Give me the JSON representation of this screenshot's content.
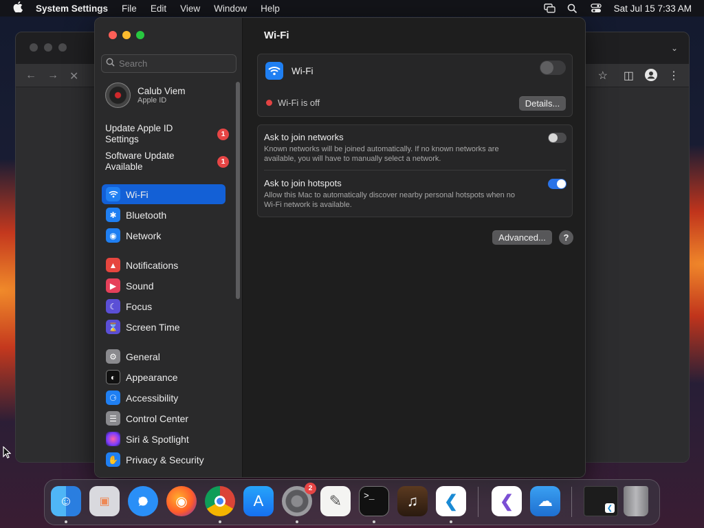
{
  "menubar": {
    "app_name": "System Settings",
    "menus": [
      "File",
      "Edit",
      "View",
      "Window",
      "Help"
    ],
    "clock": "Sat Jul 15  7:33 AM"
  },
  "sidebar": {
    "search_placeholder": "Search",
    "account": {
      "name": "Calub Viem",
      "subtitle": "Apple ID"
    },
    "notices": [
      {
        "label": "Update Apple ID Settings",
        "badge": "1"
      },
      {
        "label": "Software Update Available",
        "badge": "1"
      }
    ],
    "items": [
      {
        "label": "Wi-Fi",
        "icon": "wifi-icon",
        "color": "#1f7ff2"
      },
      {
        "label": "Bluetooth",
        "icon": "bluetooth-icon",
        "color": "#1f7ff2"
      },
      {
        "label": "Network",
        "icon": "globe-icon",
        "color": "#1f7ff2"
      },
      {
        "label": "Notifications",
        "icon": "bell-icon",
        "color": "#e6463f"
      },
      {
        "label": "Sound",
        "icon": "speaker-icon",
        "color": "#e6405a"
      },
      {
        "label": "Focus",
        "icon": "moon-icon",
        "color": "#5b4fd6"
      },
      {
        "label": "Screen Time",
        "icon": "hourglass-icon",
        "color": "#5b4fd6"
      },
      {
        "label": "General",
        "icon": "gear-icon",
        "color": "#8a8a8e"
      },
      {
        "label": "Appearance",
        "icon": "appearance-icon",
        "color": "#1c1c1c"
      },
      {
        "label": "Accessibility",
        "icon": "accessibility-icon",
        "color": "#1f7ff2"
      },
      {
        "label": "Control Center",
        "icon": "control-center-icon",
        "color": "#8a8a8e"
      },
      {
        "label": "Siri & Spotlight",
        "icon": "siri-icon",
        "color": "#a04bd6"
      },
      {
        "label": "Privacy & Security",
        "icon": "hand-icon",
        "color": "#1f7ff2"
      }
    ]
  },
  "main": {
    "title": "Wi-Fi",
    "wifi_label": "Wi-Fi",
    "wifi_enabled": false,
    "status_text": "Wi-Fi is off",
    "details_button": "Details...",
    "options": [
      {
        "title": "Ask to join networks",
        "description": "Known networks will be joined automatically. If no known networks are available, you will have to manually select a network.",
        "enabled": false
      },
      {
        "title": "Ask to join hotspots",
        "description": "Allow this Mac to automatically discover nearby personal hotspots when no Wi-Fi network is available.",
        "enabled": true
      }
    ],
    "advanced_button": "Advanced...",
    "help_button": "?"
  },
  "dock": {
    "apps": [
      {
        "name": "Finder",
        "icon": "finder-icon",
        "running": true
      },
      {
        "name": "Launchpad",
        "icon": "launchpad-icon",
        "running": false
      },
      {
        "name": "Safari",
        "icon": "safari-icon",
        "running": false
      },
      {
        "name": "Firefox",
        "icon": "firefox-icon",
        "running": false
      },
      {
        "name": "Chrome",
        "icon": "chrome-icon",
        "running": true
      },
      {
        "name": "App Store",
        "icon": "app-store-icon",
        "running": false
      },
      {
        "name": "System Settings",
        "icon": "system-settings-icon",
        "running": true,
        "badge": "2"
      },
      {
        "name": "TextEdit",
        "icon": "textedit-icon",
        "running": false
      },
      {
        "name": "Terminal",
        "icon": "terminal-icon",
        "running": true
      },
      {
        "name": "GarageBand",
        "icon": "garageband-icon",
        "running": false
      },
      {
        "name": "Visual Studio Code",
        "icon": "vscode-icon",
        "running": true
      },
      {
        "name": "Visual Studio",
        "icon": "visual-studio-icon",
        "running": false
      },
      {
        "name": "Weather",
        "icon": "weather-icon",
        "running": false
      },
      {
        "name": "Downloads",
        "icon": "downloads-stack-icon",
        "running": false
      },
      {
        "name": "Trash",
        "icon": "trash-icon",
        "running": false
      }
    ]
  },
  "colors": {
    "accent": "#1360d6",
    "badge": "#e64545",
    "toggle_on": "#2a73e8"
  }
}
